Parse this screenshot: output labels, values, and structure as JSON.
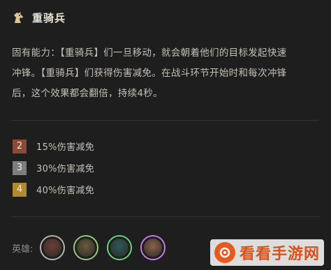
{
  "trait": {
    "name": "重骑兵",
    "icon": "horse-head-icon",
    "description_lines": [
      "固有能力：【重骑兵】们一旦移动，就会朝着他们的目标发起快速",
      "冲锋。【重骑兵】们获得伤害减免。在战斗环节开始时和每次冲锋",
      "后，这个效果都会翻倍，持续4秒。"
    ],
    "tiers": [
      {
        "count": "2",
        "text": "15%伤害减免",
        "color": "#8a4a36"
      },
      {
        "count": "3",
        "text": "30%伤害减免",
        "color": "#7d7d7d"
      },
      {
        "count": "4",
        "text": "40%伤害减免",
        "color": "#b08a2e"
      }
    ]
  },
  "champions": {
    "label": "英雄:",
    "items": [
      {
        "border": "#b9b3ad",
        "face": "#6e3e36"
      },
      {
        "border": "#8fcb7a",
        "face": "#6b5a3d"
      },
      {
        "border": "#66d27e",
        "face": "#2f5a58"
      },
      {
        "border": "#c37be0",
        "face": "#8a6248"
      }
    ]
  },
  "watermark": {
    "text": "看看手游网"
  }
}
